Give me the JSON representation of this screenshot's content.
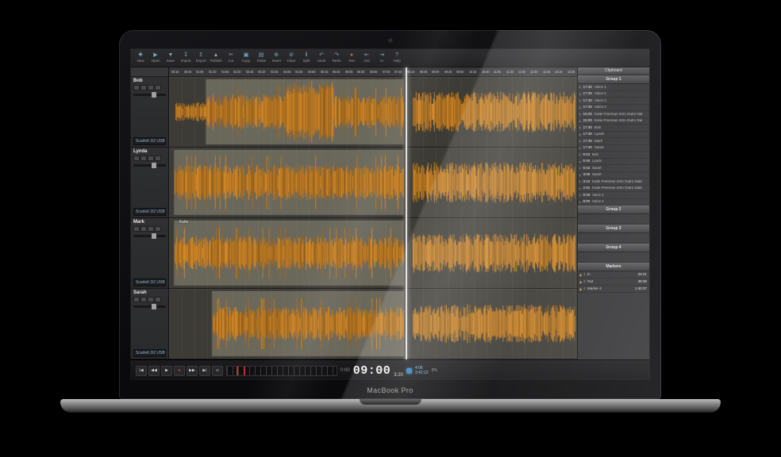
{
  "device": {
    "brand_label": "MacBook Pro"
  },
  "app": {
    "toolbar": {
      "items": [
        {
          "label": "New",
          "glyph": "✚"
        },
        {
          "label": "Open",
          "glyph": "▶"
        },
        {
          "label": "Save",
          "glyph": "▼"
        },
        {
          "label": "Import",
          "glyph": "↧"
        },
        {
          "label": "Export",
          "glyph": "↥"
        },
        {
          "label": "Publish",
          "glyph": "▲"
        },
        {
          "label": "Cut",
          "glyph": "✂"
        },
        {
          "label": "Copy",
          "glyph": "▣"
        },
        {
          "label": "Paste",
          "glyph": "▤"
        },
        {
          "label": "Insert",
          "glyph": "⊕"
        },
        {
          "label": "Clear",
          "glyph": "⊘"
        },
        {
          "label": "Split",
          "glyph": "‖"
        },
        {
          "label": "Undo",
          "glyph": "↶"
        },
        {
          "label": "Redo",
          "glyph": "↷"
        },
        {
          "label": "Rec",
          "glyph": "●"
        },
        {
          "label": "Out",
          "glyph": "⇤"
        },
        {
          "label": "In",
          "glyph": "⇥"
        },
        {
          "label": "Help",
          "glyph": "?"
        }
      ]
    },
    "ruler": {
      "ticks": [
        "00:15",
        "00:40",
        "01:05",
        "01:30",
        "01:55",
        "02:20",
        "02:45",
        "03:10",
        "03:35",
        "04:00",
        "04:25",
        "04:50",
        "05:15",
        "05:40",
        "06:05",
        "06:30",
        "06:55",
        "07:20",
        "07:45",
        "08:10",
        "08:35",
        "09:00",
        "09:25",
        "09:50",
        "10:15",
        "10:40",
        "11:05",
        "11:30",
        "11:55",
        "12:20",
        "12:45",
        "13:10",
        "13:35"
      ]
    },
    "tracks": [
      {
        "name": "Bob",
        "device": "Scarlett 2i2 USB 1",
        "clip_label": ""
      },
      {
        "name": "Lynda",
        "device": "Scarlett 2i2 USB 1",
        "clip_label": ""
      },
      {
        "name": "Mark",
        "device": "Scarlett 2i2 USB 1",
        "clip_label": "Katie"
      },
      {
        "name": "Sarah",
        "device": "Scarlett 2i2 USB 1",
        "clip_label": ""
      }
    ],
    "clipboard": {
      "title": "Clipboard",
      "groups": [
        {
          "name": "Group 1",
          "items": [
            {
              "time": "17:30",
              "label": "Voice 1"
            },
            {
              "time": "17:30",
              "label": "Voice 2"
            },
            {
              "time": "17:30",
              "label": "Voice 3"
            },
            {
              "time": "17:30",
              "label": "Voice 4"
            },
            {
              "time": "15:20",
              "label": "Katie Freeman Intro Outro Nat"
            },
            {
              "time": "15:00",
              "label": "Katie Freeman Intro Outro Daila"
            },
            {
              "time": "17:30",
              "label": "Bob"
            },
            {
              "time": "17:30",
              "label": "Lynda"
            },
            {
              "time": "17:30",
              "label": "Mark"
            },
            {
              "time": "17:30",
              "label": "Sarah"
            },
            {
              "time": "5:53",
              "label": "Bob"
            },
            {
              "time": "5:05",
              "label": "Lynda"
            },
            {
              "time": "5:53",
              "label": "Sarah"
            },
            {
              "time": "3:08",
              "label": "Sarah"
            },
            {
              "time": "3:10",
              "label": "Katie Freeman Intro Outro Daila"
            },
            {
              "time": "2:52",
              "label": "Katie Freeman Intro Outro Daila"
            },
            {
              "time": "8:08",
              "label": "Voice 1"
            },
            {
              "time": "8:00",
              "label": "Voice 2"
            }
          ]
        },
        {
          "name": "Group 2",
          "items": []
        },
        {
          "name": "Group 3",
          "items": []
        },
        {
          "name": "Group 4",
          "items": []
        }
      ],
      "markers": {
        "title": "Markers",
        "items": [
          {
            "num": "1",
            "label": "In",
            "time": "25:21"
          },
          {
            "num": "2",
            "label": "Out",
            "time": "38:39"
          },
          {
            "num": "4",
            "label": "Marker 4",
            "time": "1:40:37"
          }
        ]
      }
    },
    "transport": {
      "buttons": [
        {
          "name": "go-start",
          "glyph": "|◀"
        },
        {
          "name": "rewind",
          "glyph": "◀◀"
        },
        {
          "name": "play",
          "glyph": "▶"
        },
        {
          "name": "record",
          "glyph": "●"
        },
        {
          "name": "fast-forward",
          "glyph": "▶▶"
        },
        {
          "name": "go-end",
          "glyph": "▶|"
        },
        {
          "name": "loop",
          "glyph": "∞"
        }
      ],
      "pos_left": "0:00",
      "timecode": "09:00",
      "timecode_sub": "3:20",
      "right_top": "4:06",
      "right_bottom": "3:42:13",
      "right_pct": "0%"
    },
    "colors": {
      "wave": "#cf8d2a",
      "accent": "#6fa9cc",
      "record": "#d35454"
    }
  }
}
